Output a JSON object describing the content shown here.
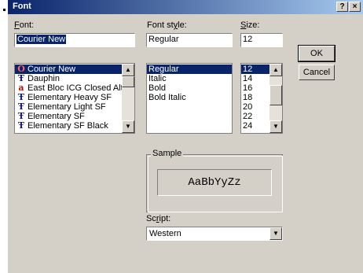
{
  "dialog": {
    "title": "Font",
    "help_glyph": "?",
    "close_glyph": "×"
  },
  "labels": {
    "font": "Font:",
    "font_style": "Font style:",
    "size": "Size:",
    "sample": "Sample",
    "script": "Script:"
  },
  "font": {
    "value": "Courier New",
    "items": [
      {
        "name": "Courier New",
        "icon": "O",
        "icon_color": "#cc0000"
      },
      {
        "name": "Dauphin",
        "icon": "Ŧ",
        "icon_color": "#1a1a80"
      },
      {
        "name": "East Bloc ICG Closed Alt",
        "icon": "a",
        "icon_color": "#cc0000"
      },
      {
        "name": "Elementary Heavy SF",
        "icon": "Ŧ",
        "icon_color": "#1a1a80"
      },
      {
        "name": "Elementary Light SF",
        "icon": "Ŧ",
        "icon_color": "#1a1a80"
      },
      {
        "name": "Elementary SF",
        "icon": "Ŧ",
        "icon_color": "#1a1a80"
      },
      {
        "name": "Elementary SF Black",
        "icon": "Ŧ",
        "icon_color": "#1a1a80"
      }
    ]
  },
  "style": {
    "value": "Regular",
    "items": [
      "Regular",
      "Italic",
      "Bold",
      "Bold Italic"
    ]
  },
  "size": {
    "value": "12",
    "items": [
      "12",
      "14",
      "16",
      "18",
      "20",
      "22",
      "24"
    ]
  },
  "buttons": {
    "ok": "OK",
    "cancel": "Cancel"
  },
  "sample_text": "AaBbYyZz",
  "script": {
    "value": "Western"
  },
  "colors": {
    "selection": "#0a246a",
    "face": "#d4d0c8"
  }
}
